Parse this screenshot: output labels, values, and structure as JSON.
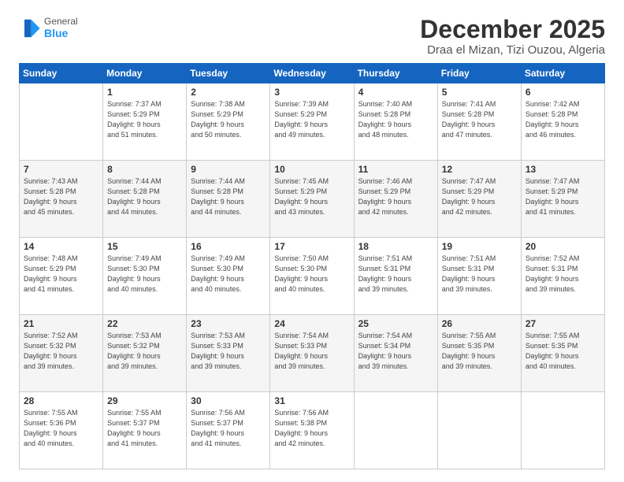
{
  "header": {
    "logo_line1": "General",
    "logo_line2": "Blue",
    "month": "December 2025",
    "location": "Draa el Mizan, Tizi Ouzou, Algeria"
  },
  "days_of_week": [
    "Sunday",
    "Monday",
    "Tuesday",
    "Wednesday",
    "Thursday",
    "Friday",
    "Saturday"
  ],
  "weeks": [
    [
      {
        "day": "",
        "info": ""
      },
      {
        "day": "1",
        "info": "Sunrise: 7:37 AM\nSunset: 5:29 PM\nDaylight: 9 hours\nand 51 minutes."
      },
      {
        "day": "2",
        "info": "Sunrise: 7:38 AM\nSunset: 5:29 PM\nDaylight: 9 hours\nand 50 minutes."
      },
      {
        "day": "3",
        "info": "Sunrise: 7:39 AM\nSunset: 5:29 PM\nDaylight: 9 hours\nand 49 minutes."
      },
      {
        "day": "4",
        "info": "Sunrise: 7:40 AM\nSunset: 5:28 PM\nDaylight: 9 hours\nand 48 minutes."
      },
      {
        "day": "5",
        "info": "Sunrise: 7:41 AM\nSunset: 5:28 PM\nDaylight: 9 hours\nand 47 minutes."
      },
      {
        "day": "6",
        "info": "Sunrise: 7:42 AM\nSunset: 5:28 PM\nDaylight: 9 hours\nand 46 minutes."
      }
    ],
    [
      {
        "day": "7",
        "info": "Sunrise: 7:43 AM\nSunset: 5:28 PM\nDaylight: 9 hours\nand 45 minutes."
      },
      {
        "day": "8",
        "info": "Sunrise: 7:44 AM\nSunset: 5:28 PM\nDaylight: 9 hours\nand 44 minutes."
      },
      {
        "day": "9",
        "info": "Sunrise: 7:44 AM\nSunset: 5:28 PM\nDaylight: 9 hours\nand 44 minutes."
      },
      {
        "day": "10",
        "info": "Sunrise: 7:45 AM\nSunset: 5:29 PM\nDaylight: 9 hours\nand 43 minutes."
      },
      {
        "day": "11",
        "info": "Sunrise: 7:46 AM\nSunset: 5:29 PM\nDaylight: 9 hours\nand 42 minutes."
      },
      {
        "day": "12",
        "info": "Sunrise: 7:47 AM\nSunset: 5:29 PM\nDaylight: 9 hours\nand 42 minutes."
      },
      {
        "day": "13",
        "info": "Sunrise: 7:47 AM\nSunset: 5:29 PM\nDaylight: 9 hours\nand 41 minutes."
      }
    ],
    [
      {
        "day": "14",
        "info": "Sunrise: 7:48 AM\nSunset: 5:29 PM\nDaylight: 9 hours\nand 41 minutes."
      },
      {
        "day": "15",
        "info": "Sunrise: 7:49 AM\nSunset: 5:30 PM\nDaylight: 9 hours\nand 40 minutes."
      },
      {
        "day": "16",
        "info": "Sunrise: 7:49 AM\nSunset: 5:30 PM\nDaylight: 9 hours\nand 40 minutes."
      },
      {
        "day": "17",
        "info": "Sunrise: 7:50 AM\nSunset: 5:30 PM\nDaylight: 9 hours\nand 40 minutes."
      },
      {
        "day": "18",
        "info": "Sunrise: 7:51 AM\nSunset: 5:31 PM\nDaylight: 9 hours\nand 39 minutes."
      },
      {
        "day": "19",
        "info": "Sunrise: 7:51 AM\nSunset: 5:31 PM\nDaylight: 9 hours\nand 39 minutes."
      },
      {
        "day": "20",
        "info": "Sunrise: 7:52 AM\nSunset: 5:31 PM\nDaylight: 9 hours\nand 39 minutes."
      }
    ],
    [
      {
        "day": "21",
        "info": "Sunrise: 7:52 AM\nSunset: 5:32 PM\nDaylight: 9 hours\nand 39 minutes."
      },
      {
        "day": "22",
        "info": "Sunrise: 7:53 AM\nSunset: 5:32 PM\nDaylight: 9 hours\nand 39 minutes."
      },
      {
        "day": "23",
        "info": "Sunrise: 7:53 AM\nSunset: 5:33 PM\nDaylight: 9 hours\nand 39 minutes."
      },
      {
        "day": "24",
        "info": "Sunrise: 7:54 AM\nSunset: 5:33 PM\nDaylight: 9 hours\nand 39 minutes."
      },
      {
        "day": "25",
        "info": "Sunrise: 7:54 AM\nSunset: 5:34 PM\nDaylight: 9 hours\nand 39 minutes."
      },
      {
        "day": "26",
        "info": "Sunrise: 7:55 AM\nSunset: 5:35 PM\nDaylight: 9 hours\nand 39 minutes."
      },
      {
        "day": "27",
        "info": "Sunrise: 7:55 AM\nSunset: 5:35 PM\nDaylight: 9 hours\nand 40 minutes."
      }
    ],
    [
      {
        "day": "28",
        "info": "Sunrise: 7:55 AM\nSunset: 5:36 PM\nDaylight: 9 hours\nand 40 minutes."
      },
      {
        "day": "29",
        "info": "Sunrise: 7:55 AM\nSunset: 5:37 PM\nDaylight: 9 hours\nand 41 minutes."
      },
      {
        "day": "30",
        "info": "Sunrise: 7:56 AM\nSunset: 5:37 PM\nDaylight: 9 hours\nand 41 minutes."
      },
      {
        "day": "31",
        "info": "Sunrise: 7:56 AM\nSunset: 5:38 PM\nDaylight: 9 hours\nand 42 minutes."
      },
      {
        "day": "",
        "info": ""
      },
      {
        "day": "",
        "info": ""
      },
      {
        "day": "",
        "info": ""
      }
    ]
  ]
}
